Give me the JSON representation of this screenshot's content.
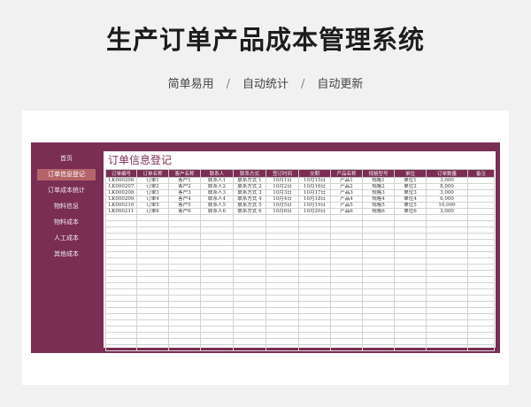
{
  "hero": {
    "title": "生产订单产品成本管理系统",
    "features": [
      "简单易用",
      "自动统计",
      "自动更新"
    ],
    "separator": "/"
  },
  "sidebar": {
    "items": [
      {
        "label": "首页",
        "active": false
      },
      {
        "label": "订单信息登记",
        "active": true
      },
      {
        "label": "订单成本统计",
        "active": false
      },
      {
        "label": "物料信息",
        "active": false
      },
      {
        "label": "物料成本",
        "active": false
      },
      {
        "label": "人工成本",
        "active": false
      },
      {
        "label": "其他成本",
        "active": false
      }
    ]
  },
  "content": {
    "title": "订单信息登记",
    "columns": [
      "订单编号",
      "订单名称",
      "客户名称",
      "联系人",
      "联系方式",
      "签订时间",
      "交期",
      "产品名称",
      "规格型号",
      "单位",
      "订单数量",
      "备注"
    ],
    "rows": [
      [
        "LK000206",
        "订单1",
        "客户1",
        "联系人1",
        "联系方式 1",
        "10月1日",
        "10月15日",
        "产品1",
        "规格1",
        "单位1",
        "3,000",
        ""
      ],
      [
        "LK000207",
        "订单2",
        "客户2",
        "联系人2",
        "联系方式 2",
        "10月2日",
        "10月16日",
        "产品2",
        "规格2",
        "单位2",
        "8,000",
        ""
      ],
      [
        "LK000208",
        "订单3",
        "客户3",
        "联系人3",
        "联系方式 3",
        "10月3日",
        "10月17日",
        "产品3",
        "规格3",
        "单位3",
        "3,000",
        ""
      ],
      [
        "LK000209",
        "订单4",
        "客户4",
        "联系人4",
        "联系方式 4",
        "10月4日",
        "10月18日",
        "产品4",
        "规格4",
        "单位4",
        "6,000",
        ""
      ],
      [
        "LK000210",
        "订单5",
        "客户5",
        "联系人5",
        "联系方式 5",
        "10月5日",
        "10月19日",
        "产品5",
        "规格5",
        "单位5",
        "10,000",
        ""
      ],
      [
        "LK000211",
        "订单6",
        "客户6",
        "联系人6",
        "联系方式 6",
        "10月6日",
        "10月20日",
        "产品6",
        "规格6",
        "单位6",
        "3,000",
        ""
      ]
    ],
    "empty_rows": 22
  },
  "colors": {
    "accent": "#7a2e54",
    "active_item": "#b5646a",
    "page_bg": "#f1f1f1"
  }
}
